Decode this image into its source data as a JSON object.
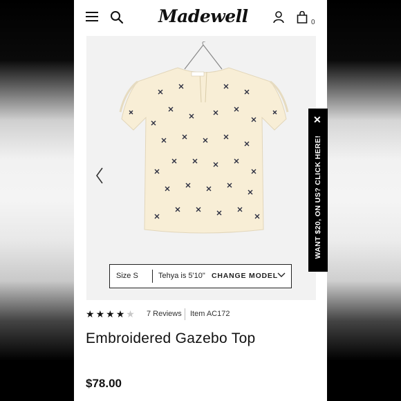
{
  "header": {
    "brand": "Madewell",
    "bag_count": "0"
  },
  "product_gallery": {
    "model_info": {
      "size": "Size S",
      "height": "Tehya is 5'10\"",
      "change_model_label": "CHANGE MODEL"
    }
  },
  "product": {
    "rating": 4,
    "rating_max": 5,
    "reviews": "7 Reviews",
    "item_code": "Item AC172",
    "title": "Embroidered Gazebo Top",
    "price": "$78.00"
  },
  "promo": {
    "close_glyph": "✕",
    "text": "WANT $20, ON US? CLICK HERE!"
  },
  "icons": [
    "menu-icon",
    "search-icon",
    "user-icon",
    "shopping-bag-icon",
    "chevron-left-icon",
    "chevron-down-icon",
    "star-icon",
    "close-icon"
  ],
  "colors": {
    "accent": "#000000",
    "image_bg": "#f2f2f2",
    "star_empty": "#c8c8c8"
  }
}
